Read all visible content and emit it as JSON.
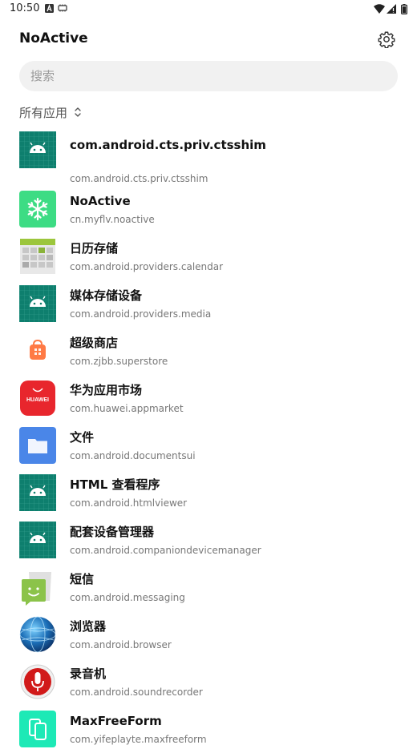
{
  "status_bar": {
    "time": "10:50"
  },
  "app_bar": {
    "title": "NoActive"
  },
  "search": {
    "placeholder": "搜索"
  },
  "filter": {
    "label": "所有应用"
  },
  "apps": [
    {
      "name": "com.android.cts.priv.ctsshim",
      "package": "com.android.cts.priv.ctsshim",
      "icon": "android-icon"
    },
    {
      "name": "NoActive",
      "package": "cn.myflv.noactive",
      "icon": "snowflake-icon"
    },
    {
      "name": "日历存储",
      "package": "com.android.providers.calendar",
      "icon": "calendar-storage-icon"
    },
    {
      "name": "媒体存储设备",
      "package": "com.android.providers.media",
      "icon": "android-icon"
    },
    {
      "name": "超级商店",
      "package": "com.zjbb.superstore",
      "icon": "shopping-bag-icon"
    },
    {
      "name": "华为应用市场",
      "package": "com.huawei.appmarket",
      "icon": "huawei-appmarket-icon"
    },
    {
      "name": "文件",
      "package": "com.android.documentsui",
      "icon": "folder-icon"
    },
    {
      "name": "HTML 查看程序",
      "package": "com.android.htmlviewer",
      "icon": "android-icon"
    },
    {
      "name": "配套设备管理器",
      "package": "com.android.companiondevicemanager",
      "icon": "android-icon"
    },
    {
      "name": "短信",
      "package": "com.android.messaging",
      "icon": "messaging-icon"
    },
    {
      "name": "浏览器",
      "package": "com.android.browser",
      "icon": "globe-icon"
    },
    {
      "name": "录音机",
      "package": "com.android.soundrecorder",
      "icon": "microphone-icon"
    },
    {
      "name": "MaxFreeForm",
      "package": "com.yifeplayte.maxfreeform",
      "icon": "freeform-window-icon"
    }
  ],
  "colors": {
    "android_tile": "#0e7f6e",
    "noactive_tile": "#3ddc84",
    "huawei_red": "#e8262d",
    "folder_blue": "#4a86e8",
    "store_orange": "#ff7a45",
    "mic_red": "#d11a1a",
    "freeform_cyan": "#1de9b6"
  }
}
